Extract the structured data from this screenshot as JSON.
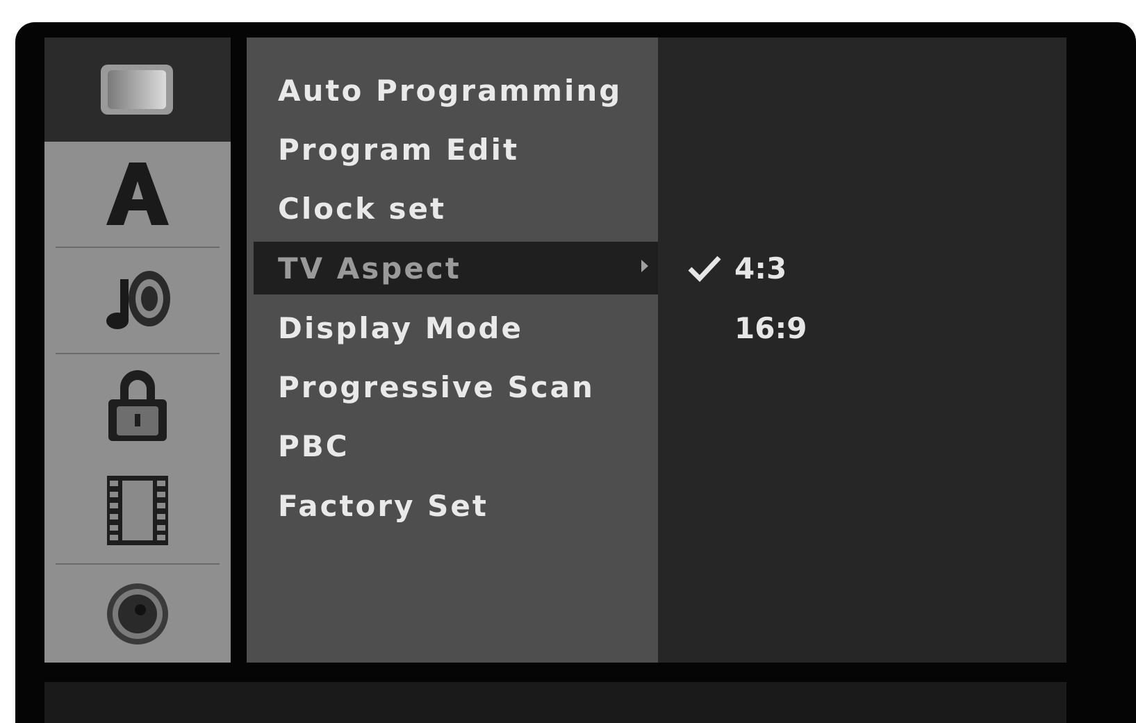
{
  "left_icons": [
    {
      "name": "tv-screen-icon",
      "active": true
    },
    {
      "name": "language-a-icon",
      "active": false
    },
    {
      "name": "audio-note-icon",
      "active": false
    },
    {
      "name": "lock-icon",
      "active": false
    },
    {
      "name": "film-icon",
      "active": false
    },
    {
      "name": "disc-icon",
      "active": false
    }
  ],
  "menu": {
    "items": [
      {
        "label": "Auto Programming"
      },
      {
        "label": "Program Edit"
      },
      {
        "label": "Clock set"
      },
      {
        "label": "TV Aspect"
      },
      {
        "label": "Display Mode"
      },
      {
        "label": "Progressive Scan"
      },
      {
        "label": "PBC"
      },
      {
        "label": "Factory Set"
      }
    ],
    "selected_index": 3
  },
  "options": {
    "items": [
      {
        "label": "4:3",
        "checked": true
      },
      {
        "label": "16:9",
        "checked": false
      }
    ]
  }
}
